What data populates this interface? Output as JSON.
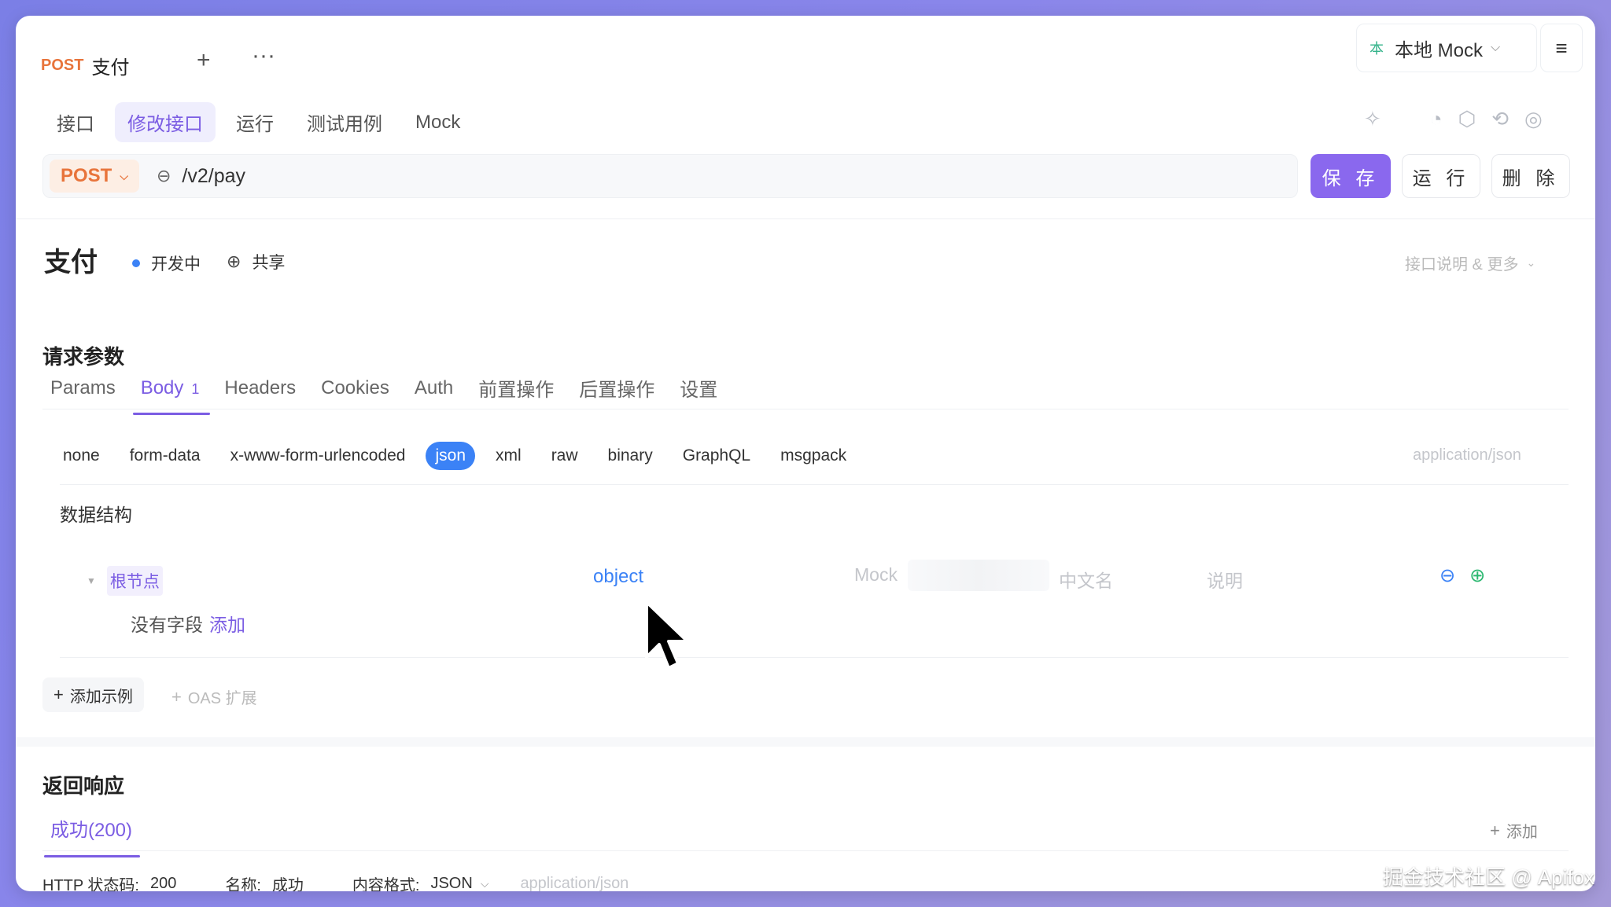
{
  "tab": {
    "method": "POST",
    "title": "支付",
    "add_icon": "plus-icon",
    "more_icon": "more-icon"
  },
  "env": {
    "badge": "本",
    "label": "本地 Mock"
  },
  "top_tabs": [
    "接口",
    "修改接口",
    "运行",
    "测试用例",
    "Mock"
  ],
  "url_bar": {
    "method": "POST",
    "path": "/v2/pay"
  },
  "actions": {
    "save": "保 存",
    "run": "运 行",
    "delete": "删 除"
  },
  "api": {
    "name": "支付",
    "status": "开发中",
    "visibility": "共享",
    "more": "接口说明 & 更多"
  },
  "request": {
    "title": "请求参数",
    "tabs": {
      "params": "Params",
      "body": "Body",
      "body_count": "1",
      "headers": "Headers",
      "cookies": "Cookies",
      "auth": "Auth",
      "pre": "前置操作",
      "post": "后置操作",
      "settings": "设置"
    },
    "body_types": [
      "none",
      "form-data",
      "x-www-form-urlencoded",
      "json",
      "xml",
      "raw",
      "binary",
      "GraphQL",
      "msgpack"
    ],
    "content_type": "application/json",
    "schema_label": "数据结构",
    "root": {
      "name": "根节点",
      "type": "object",
      "mock": "Mock",
      "cn_name": "中文名",
      "desc": "说明"
    },
    "empty": {
      "text": "没有字段",
      "add": "添加"
    },
    "add_example": "添加示例",
    "oas_ext": "OAS 扩展"
  },
  "response": {
    "title": "返回响应",
    "tab": "成功(200)",
    "add": "添加",
    "status_label": "HTTP 状态码:",
    "status_value": "200",
    "name_label": "名称:",
    "name_value": "成功",
    "format_label": "内容格式:",
    "format_value": "JSON",
    "content_type": "application/json"
  },
  "watermark": "掘金技术社区 @ Apifox"
}
